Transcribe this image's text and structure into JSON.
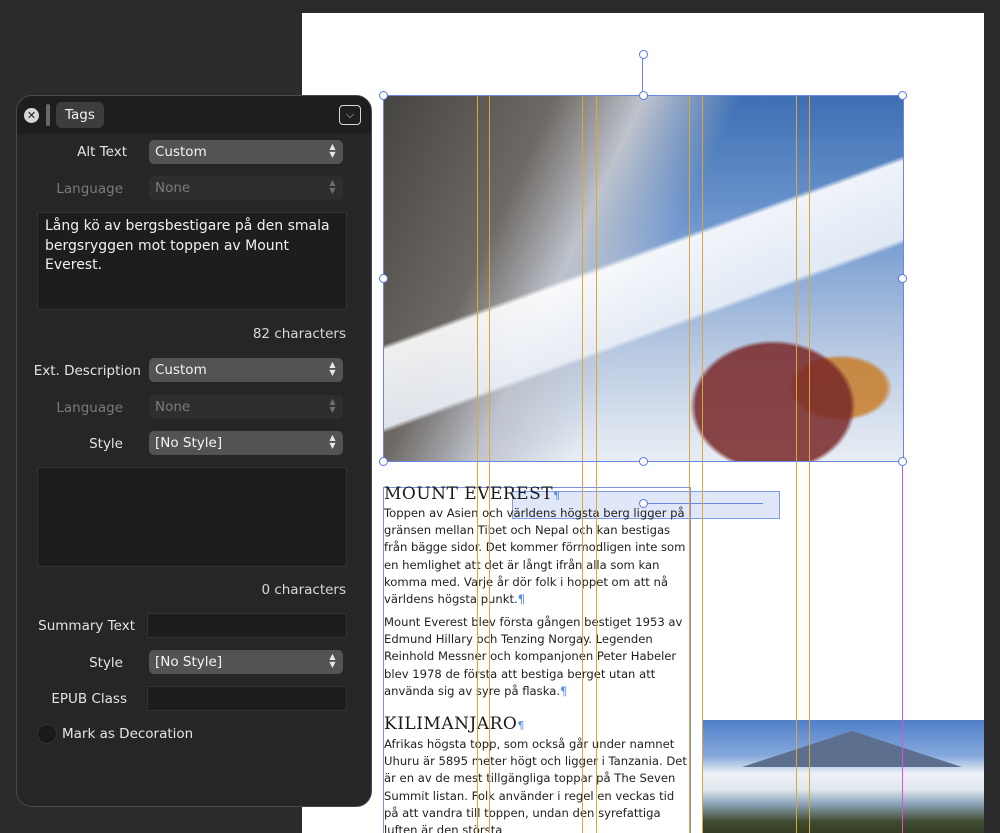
{
  "panel": {
    "tab_label": "Tags",
    "close_label": "✕",
    "collapse_label": "⌵",
    "alt_text": {
      "label": "Alt Text",
      "value": "Custom",
      "language_label": "Language",
      "language_value": "None",
      "text": "Lång kö av bergsbestigare på den smala bergsryggen mot toppen av Mount Everest.",
      "count": "82 characters"
    },
    "ext_description": {
      "label": "Ext. Description",
      "value": "Custom",
      "language_label": "Language",
      "language_value": "None",
      "style_label": "Style",
      "style_value": "[No Style]",
      "text": "",
      "count": "0 characters"
    },
    "summary": {
      "label": "Summary Text",
      "value": "",
      "style_label": "Style",
      "style_value": "[No Style]"
    },
    "epub_class": {
      "label": "EPUB Class",
      "value": ""
    },
    "decoration": {
      "label": "Mark as Decoration",
      "checked": false
    }
  },
  "document": {
    "heading1": "MOUNT EVEREST",
    "pilcrow": "¶",
    "para1": "Toppen av Asien och världens högsta berg ligger på gränsen mellan Tibet och Nepal och kan bestigas från bägge sidor. Det kommer förmodligen inte som en hemlighet att det är långt ifrån alla som kan komma med. Varje år dör folk i hoppet om att nå världens högsta punkt.",
    "para2": "Mount Everest blev första gången bestiget 1953 av Edmund Hillary och Tenzing Norgay. Legenden Reinhold Messner och kompanjonen Peter Habeler blev 1978 de första att bestiga berget utan att använda sig av syre på flaska.",
    "heading2": "KILIMANJARO",
    "para3": "Afrikas högsta topp, som också går under namnet Uhuru är 5895 meter högt och ligger i Tanzania. Det är en av de mest tillgängliga toppar på The Seven Summit listan. Folk använder i regel en veckas tid på att vandra till toppen, undan den syrefattiga luften är den största"
  },
  "colors": {
    "guide": "#e0a53a",
    "selection": "#6b86e8",
    "margin_guide": "#e04fd6"
  }
}
